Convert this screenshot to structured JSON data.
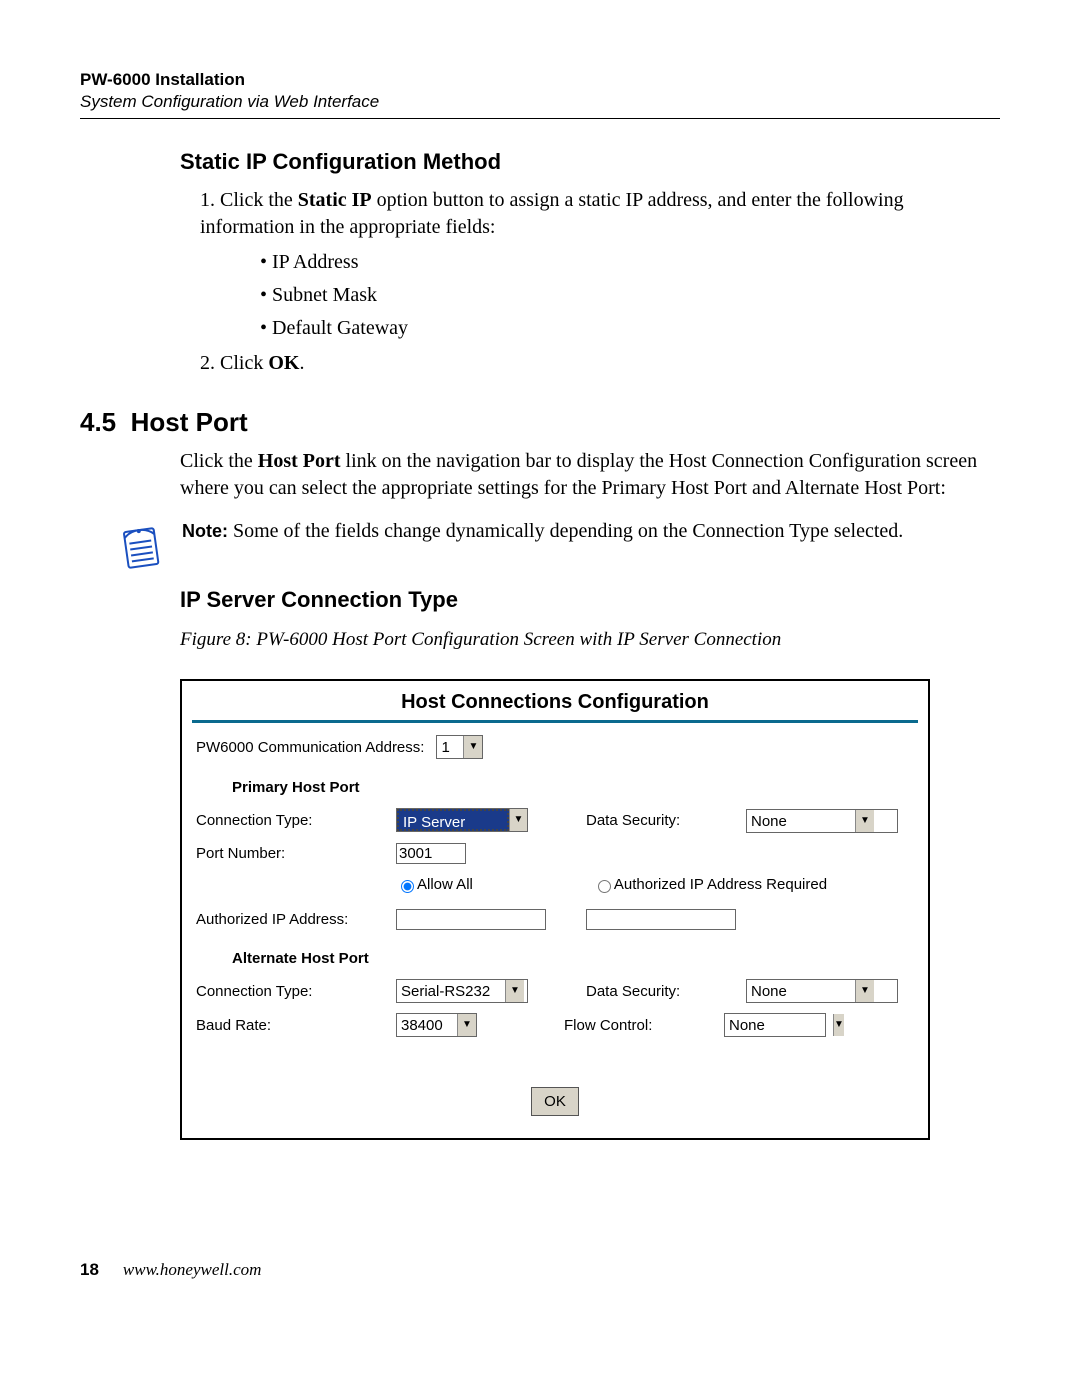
{
  "header": {
    "title": "PW-6000 Installation",
    "subtitle": "System Configuration via Web Interface"
  },
  "static_ip": {
    "heading": "Static IP Configuration Method",
    "step1_num": "1.",
    "step1_a": "Click the ",
    "step1_bold": "Static IP",
    "step1_b": " option button to assign a static IP address, and enter the following information in the appropriate fields:",
    "bullets": [
      "IP Address",
      "Subnet Mask",
      "Default Gateway"
    ],
    "step2_num": "2.",
    "step2_a": "Click ",
    "step2_bold": "OK",
    "step2_b": "."
  },
  "host_port": {
    "section_num": "4.5",
    "section_title": "Host Port",
    "intro_a": "Click the ",
    "intro_bold": "Host Port",
    "intro_b": " link on the navigation bar to display the Host Connection Configuration screen where you can select the appropriate settings for the Primary Host Port and Alternate Host Port:",
    "note_label": "Note:",
    "note_text": " Some of the fields change dynamically depending on the Connection Type selected.",
    "sub_heading": "IP Server Connection Type",
    "figure_caption": "Figure 8:    PW-6000 Host Port Configuration Screen with IP Server Connection"
  },
  "ui": {
    "title": "Host Connections Configuration",
    "comm_addr_label": "PW6000 Communication Address:",
    "comm_addr_value": "1",
    "primary_heading": "Primary Host Port",
    "conn_type_label": "Connection Type:",
    "primary_conn_type": "IP Server",
    "data_security_label": "Data Security:",
    "primary_data_security": "None",
    "port_number_label": "Port Number:",
    "port_number_value": "3001",
    "allow_all_label": "Allow All",
    "auth_required_label": "Authorized IP Address Required",
    "auth_ip_label": "Authorized IP Address:",
    "auth_ip_value1": "",
    "auth_ip_value2": "",
    "alternate_heading": "Alternate Host Port",
    "alt_conn_type": "Serial-RS232",
    "alt_data_security": "None",
    "baud_label": "Baud Rate:",
    "baud_value": "38400",
    "flow_label": "Flow Control:",
    "flow_value": "None",
    "ok_label": "OK"
  },
  "footer": {
    "page": "18",
    "site": "www.honeywell.com"
  }
}
